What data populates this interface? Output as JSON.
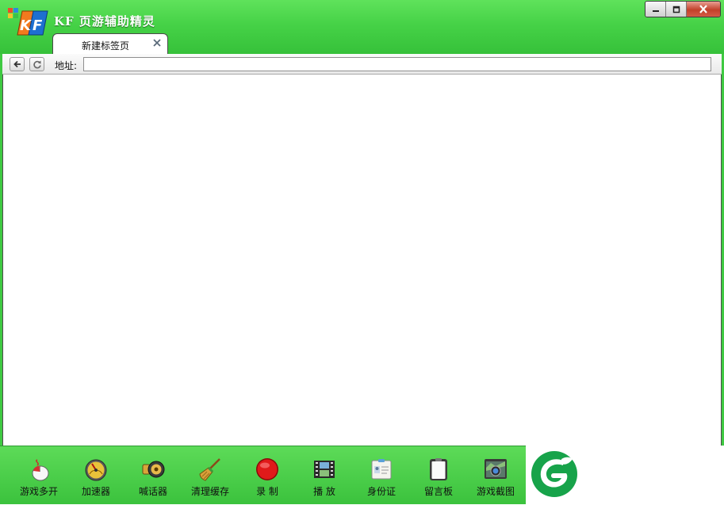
{
  "app": {
    "title": "KF 页游辅助精灵"
  },
  "window_controls": {
    "minimize": "minimize",
    "maximize": "maximize",
    "close": "close"
  },
  "tabs": [
    {
      "label": "新建标签页",
      "active": true
    }
  ],
  "address_bar": {
    "label": "地址:",
    "value": ""
  },
  "toolbar": {
    "items": [
      {
        "label": "游戏多开",
        "icon": "mouse-icon"
      },
      {
        "label": "加速器",
        "icon": "speedometer-icon"
      },
      {
        "label": "喊话器",
        "icon": "speaker-icon"
      },
      {
        "label": "清理缓存",
        "icon": "broom-icon"
      },
      {
        "label": "录 制",
        "icon": "record-icon"
      },
      {
        "label": "播 放",
        "icon": "film-icon"
      },
      {
        "label": "身份证",
        "icon": "id-card-icon"
      },
      {
        "label": "留言板",
        "icon": "clipboard-icon"
      },
      {
        "label": "游戏截图",
        "icon": "camera-icon"
      }
    ]
  },
  "colors": {
    "accent_green": "#46d247",
    "dark_green": "#2a8f2e",
    "brand_green": "#17a34a",
    "close_red": "#c2402a"
  }
}
